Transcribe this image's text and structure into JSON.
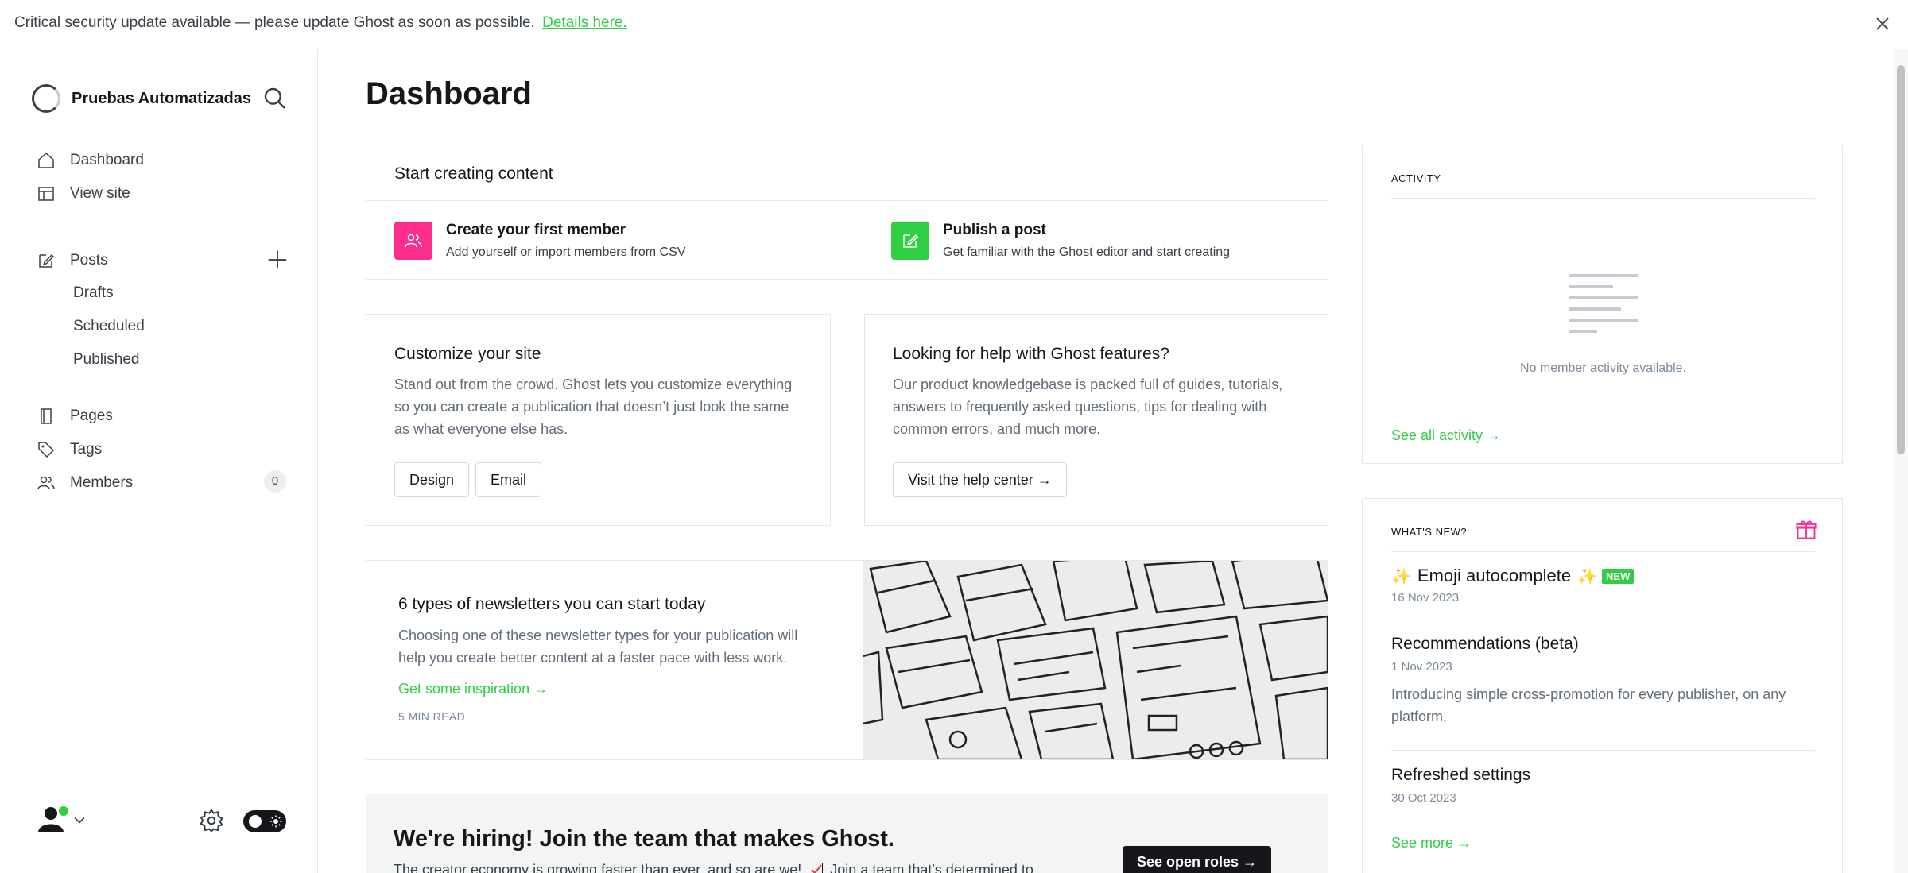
{
  "banner": {
    "text": "Critical security update available — please update Ghost as soon as possible.",
    "link": "Details here."
  },
  "sidebar": {
    "site_name": "Pruebas Automatizadas",
    "nav": {
      "dashboard": "Dashboard",
      "view_site": "View site",
      "posts": "Posts",
      "drafts": "Drafts",
      "scheduled": "Scheduled",
      "published": "Published",
      "pages": "Pages",
      "tags": "Tags",
      "members": "Members",
      "members_count": "0"
    }
  },
  "main": {
    "title": "Dashboard",
    "start": {
      "heading": "Start creating content",
      "member_title": "Create your first member",
      "member_desc": "Add yourself or import members from CSV",
      "post_title": "Publish a post",
      "post_desc": "Get familiar with the Ghost editor and start creating"
    },
    "customize": {
      "heading": "Customize your site",
      "body": "Stand out from the crowd. Ghost lets you customize everything so you can create a publication that doesn’t just look the same as what everyone else has.",
      "design_btn": "Design",
      "email_btn": "Email"
    },
    "help": {
      "heading": "Looking for help with Ghost features?",
      "body": "Our product knowledgebase is packed full of guides, tutorials, answers to frequently asked questions, tips for dealing with common errors, and much more.",
      "btn": "Visit the help center →"
    },
    "newsletter": {
      "heading": "6 types of newsletters you can start today",
      "body": "Choosing one of these newsletter types for your publication will help you create better content at a faster pace with less work.",
      "link": "Get some inspiration →",
      "meta": "5 MIN READ"
    },
    "hiring": {
      "heading": "We're hiring! Join the team that makes Ghost.",
      "body_start": "The creator economy is growing faster than ever, and so are we!",
      "body_end": "Join a team that's determined to",
      "btn": "See open roles →"
    }
  },
  "activity": {
    "heading": "ACTIVITY",
    "empty": "No member activity available.",
    "link": "See all activity →"
  },
  "whats_new": {
    "heading": "WHAT'S NEW?",
    "items": [
      {
        "title": "Emoji autocomplete",
        "badge": "NEW",
        "date": "16 Nov 2023"
      },
      {
        "title": "Recommendations (beta)",
        "date": "1 Nov 2023",
        "desc": "Introducing simple cross-promotion for every publisher, on any platform."
      },
      {
        "title": "Refreshed settings",
        "date": "30 Oct 2023"
      }
    ],
    "more": "See more →"
  },
  "colors": {
    "accent_green": "#30cf43",
    "member_tile": "#fb2d8d",
    "post_tile": "#30cf43"
  }
}
